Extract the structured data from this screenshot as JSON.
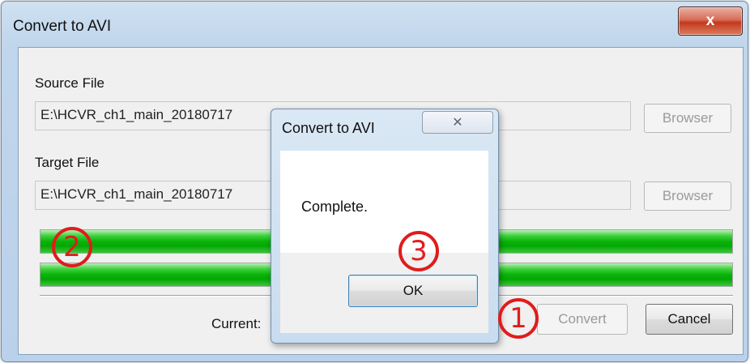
{
  "window": {
    "title": "Convert to AVI",
    "close_glyph": "x"
  },
  "source": {
    "label": "Source File",
    "value": "E:\\HCVR_ch1_main_20180717",
    "browse_label": "Browser"
  },
  "target": {
    "label": "Target File",
    "value": "E:\\HCVR_ch1_main_20180717",
    "browse_label": "Browser"
  },
  "progress": {
    "bar1_percent": 100,
    "bar2_percent": 100,
    "color": "#08b408"
  },
  "footer": {
    "current_label": "Current:",
    "convert_label": "Convert",
    "cancel_label": "Cancel"
  },
  "dialog": {
    "title": "Convert to AVI",
    "close_glyph": "✕",
    "message": "Complete.",
    "ok_label": "OK"
  },
  "annotations": {
    "marker1": "1",
    "marker2": "2",
    "marker3": "3",
    "color": "#e01c1c"
  }
}
